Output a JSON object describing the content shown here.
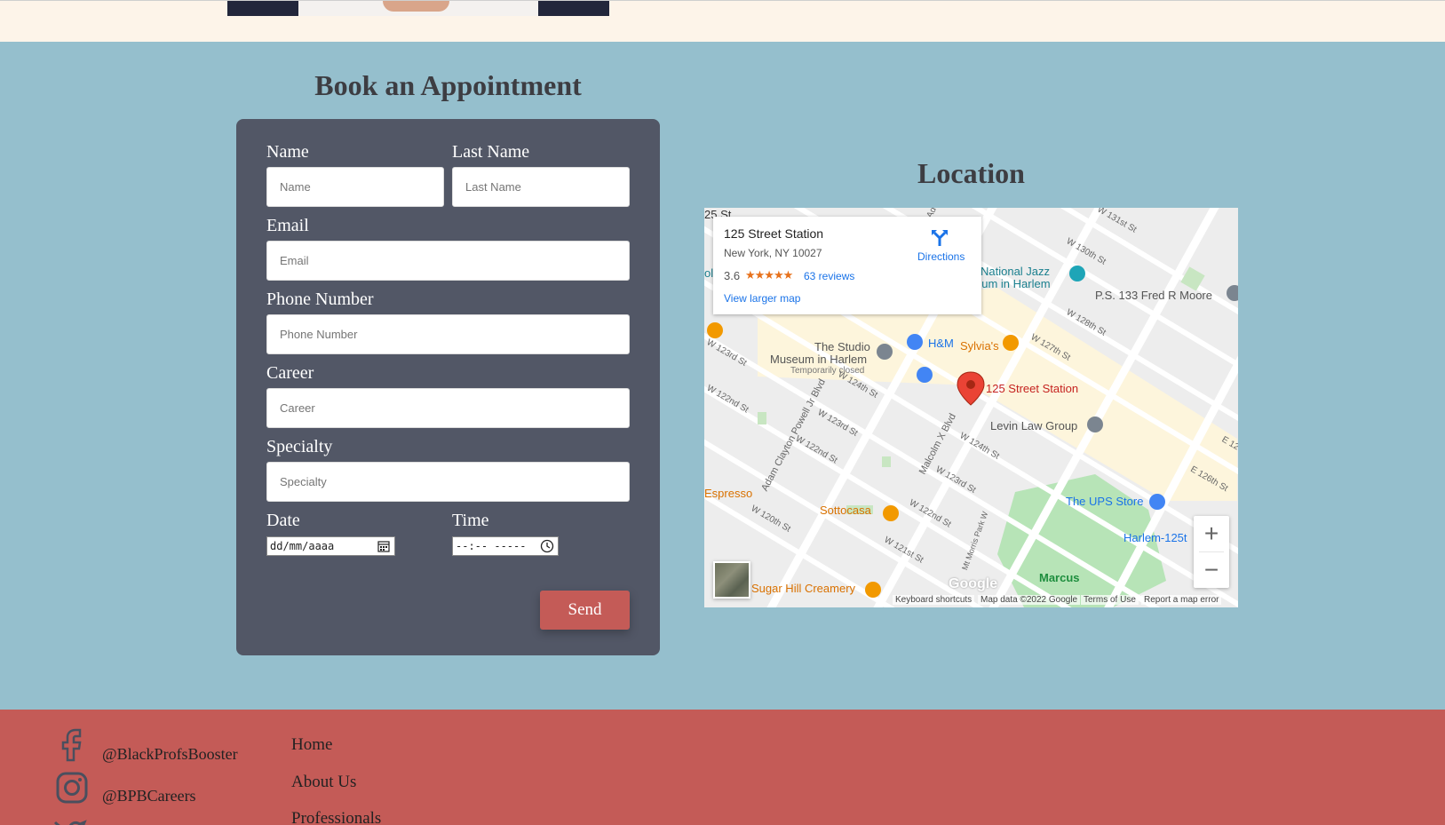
{
  "appointment": {
    "title": "Book an Appointment",
    "fields": {
      "name_label": "Name",
      "name_placeholder": "Name",
      "last_name_label": "Last Name",
      "last_name_placeholder": "Last Name",
      "email_label": "Email",
      "email_placeholder": "Email",
      "phone_label": "Phone Number",
      "phone_placeholder": "Phone Number",
      "career_label": "Career",
      "career_placeholder": "Career",
      "specialty_label": "Specialty",
      "specialty_placeholder": "Specialty",
      "date_label": "Date",
      "date_value": "dd/mm/aaaa",
      "time_label": "Time",
      "time_value": "--:-- -----"
    },
    "send_label": "Send"
  },
  "location": {
    "title": "Location",
    "info": {
      "name": "125 Street Station",
      "address": "New York, NY 10027",
      "rating": "3.6",
      "stars": "★★★★★",
      "reviews": "63 reviews",
      "larger_map": "View larger map",
      "directions": "Directions"
    },
    "places": {
      "national_jazz": "National Jazz",
      "museum_harlem": "eum in Harlem",
      "ps133": "P.S. 133 Fred R Moore",
      "studio1": "The Studio",
      "studio2": "Museum in Harlem",
      "studio3": "Temporarily closed",
      "hm": "H&M",
      "sylvias": "Sylvia's",
      "station": "125 Street Station",
      "levin": "Levin Law Group",
      "espresso": "Espresso",
      "sottocasa": "Sottocasa",
      "ups": "The UPS Store",
      "harlem125": "Harlem-125t",
      "marcus": "Marcus",
      "sugarhill": "Sugar Hill Creamery",
      "st25": "25 St",
      "ol": "ol"
    },
    "streets": {
      "w131": "W 131st St",
      "w130": "W 130th St",
      "w128": "W 128th St",
      "w127": "W 127th St",
      "w123a": "W 123rd St",
      "w122a": "W 122nd St",
      "w124a": "W 124th St",
      "w123b": "W 123rd St",
      "w122b": "W 122nd St",
      "w124b": "W 124th St",
      "w123c": "W 123rd St",
      "w122c": "W 122nd St",
      "w120": "W 120th St",
      "w121": "W 121st St",
      "e12": "E 12",
      "e126": "E 126th St",
      "acp": "Adam Clayton Powell Jr Blvd",
      "mx": "Malcolm X Blvd",
      "mtmorris": "Mt Morris Park W",
      "ac": "Ad"
    },
    "attribution": {
      "google": "Google",
      "keyboard": "Keyboard shortcuts",
      "mapdata": "Map data ©2022 Google",
      "terms": "Terms of Use",
      "report": "Report a map error"
    },
    "zoom_in": "+",
    "zoom_out": "−"
  },
  "footer": {
    "facebook": "@BlackProfsBooster",
    "instagram": "@BPBCareers",
    "links": [
      "Home",
      "About Us",
      "Professionals"
    ]
  },
  "colors": {
    "main_bg": "#95bfcd",
    "top_band": "#fdf4e9",
    "card": "#525766",
    "accent": "#c45b57",
    "heading": "#3d3d42"
  }
}
